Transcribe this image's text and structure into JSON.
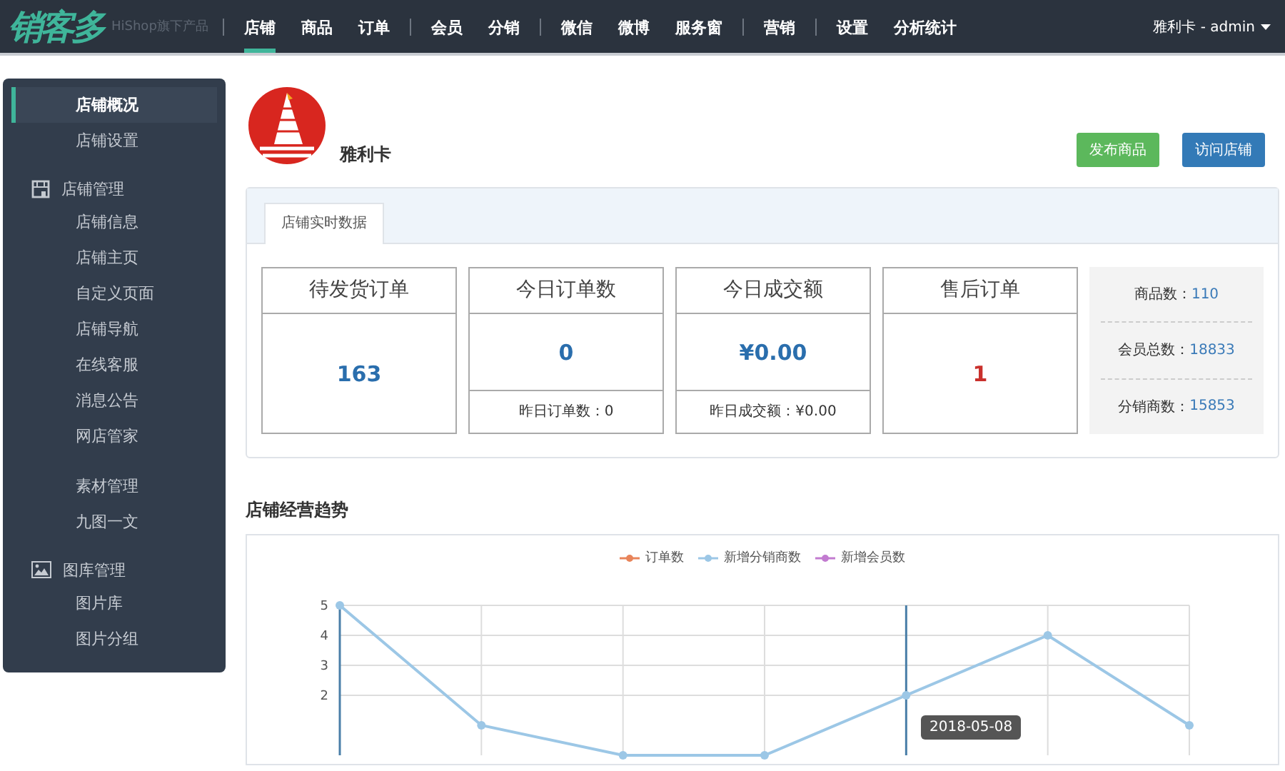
{
  "brand": {
    "logo": "销客多",
    "tagline": "HiShop旗下产品"
  },
  "nav": [
    [
      {
        "label": "店铺",
        "selected": true
      },
      {
        "label": "商品",
        "selected": false
      },
      {
        "label": "订单",
        "selected": false
      }
    ],
    [
      {
        "label": "会员",
        "selected": false
      },
      {
        "label": "分销",
        "selected": false
      }
    ],
    [
      {
        "label": "微信",
        "selected": false
      },
      {
        "label": "微博",
        "selected": false
      },
      {
        "label": "服务窗",
        "selected": false
      }
    ],
    [
      {
        "label": "营销",
        "selected": false
      }
    ],
    [
      {
        "label": "设置",
        "selected": false
      },
      {
        "label": "分析统计",
        "selected": false
      }
    ]
  ],
  "user": "雅利卡 - admin",
  "sidebar": [
    {
      "items": [
        {
          "label": "店铺概况",
          "selected": true
        },
        {
          "label": "店铺设置",
          "selected": false
        }
      ]
    },
    {
      "kind": "store",
      "title": "店铺管理",
      "items": [
        {
          "label": "店铺信息",
          "selected": false
        },
        {
          "label": "店铺主页",
          "selected": false
        },
        {
          "label": "自定义页面",
          "selected": false
        },
        {
          "label": "店铺导航",
          "selected": false
        },
        {
          "label": "在线客服",
          "selected": false
        },
        {
          "label": "消息公告",
          "selected": false
        },
        {
          "label": "网店管家",
          "selected": false
        }
      ]
    },
    {
      "items": [
        {
          "label": "素材管理",
          "selected": false
        },
        {
          "label": "九图一文",
          "selected": false
        }
      ]
    },
    {
      "kind": "gallery",
      "title": "图库管理",
      "items": [
        {
          "label": "图片库",
          "selected": false
        },
        {
          "label": "图片分组",
          "selected": false
        }
      ]
    }
  ],
  "shop": {
    "name": "雅利卡",
    "buttons": [
      {
        "label": "发布商品",
        "color": "#5cb85c"
      },
      {
        "label": "访问店铺",
        "color": "#337ab7"
      }
    ]
  },
  "panel": {
    "tabs": [
      {
        "label": "店铺实时数据",
        "selected": true
      }
    ],
    "cards": [
      {
        "title": "待发货订单",
        "value": "163",
        "color": "#2a6ead"
      },
      {
        "title": "今日订单数",
        "value": "0",
        "color": "#2a6ead",
        "footer": "昨日订单数：0"
      },
      {
        "title": "今日成交额",
        "value": "¥0.00",
        "color": "#2a6ead",
        "footer": "昨日成交额：¥0.00"
      },
      {
        "title": "售后订单",
        "value": "1",
        "color": "#c9302c"
      }
    ],
    "totals": [
      {
        "label": "商品数：",
        "value": "110"
      },
      {
        "label": "会员总数：",
        "value": "18833"
      },
      {
        "label": "分销商数：",
        "value": "15853"
      }
    ]
  },
  "trend": {
    "title": "店铺经营趋势",
    "tooltip": "2018-05-08",
    "chart_data": {
      "type": "line",
      "ylim": [
        0,
        5
      ],
      "yticks": [
        2,
        3,
        4,
        5
      ],
      "grid": true,
      "series": [
        {
          "name": "订单数",
          "color": "#e8845a"
        },
        {
          "name": "新增分销商数",
          "color": "#9cc7e6",
          "marker": "circle",
          "values": [
            5,
            1,
            0,
            0,
            2,
            4,
            1
          ]
        },
        {
          "name": "新增会员数",
          "color": "#c27bd0"
        }
      ]
    }
  }
}
